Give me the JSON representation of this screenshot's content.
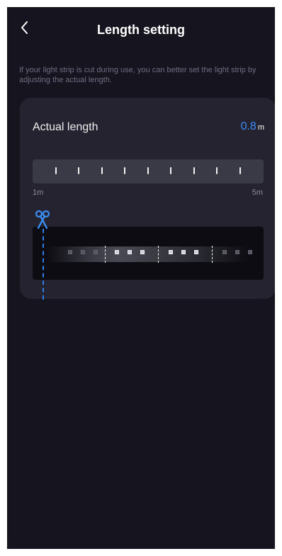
{
  "header": {
    "title": "Length setting",
    "back_icon": "chevron-left-icon"
  },
  "hint": "If your light strip is cut during use, you can better set the light strip by adjusting the actual length.",
  "card": {
    "label": "Actual length",
    "value": "0.8",
    "unit": "m",
    "ruler": {
      "min_label": "1m",
      "max_label": "5m",
      "tick_count": 9
    },
    "scissors_icon": "scissors-icon",
    "accent_color": "#3b8df7"
  }
}
